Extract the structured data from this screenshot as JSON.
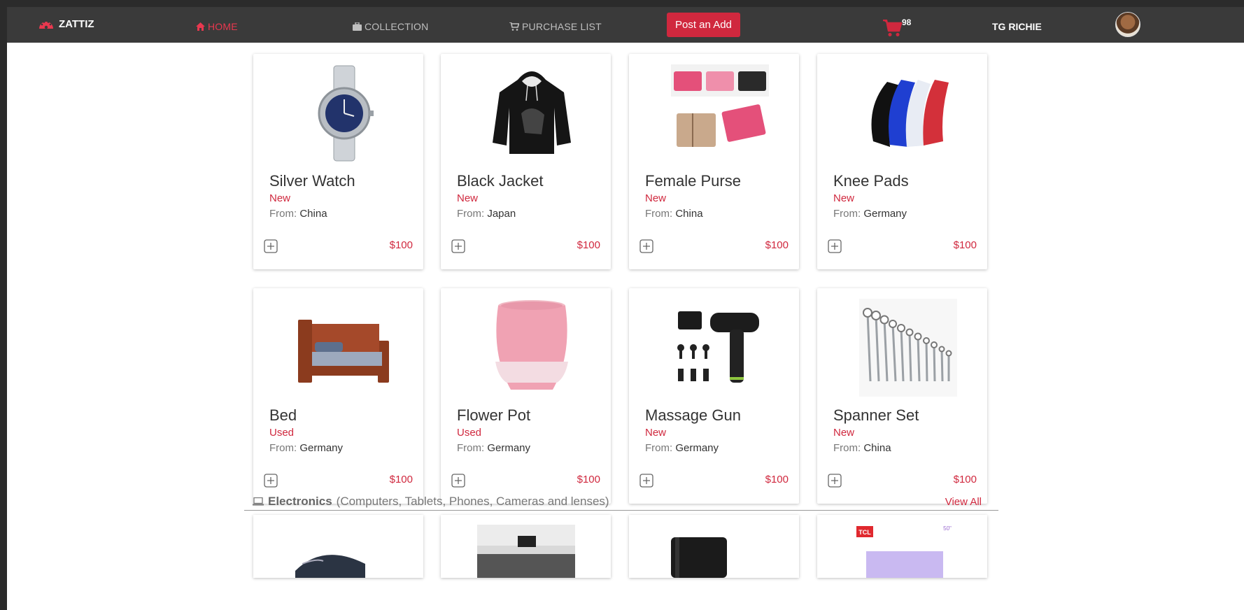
{
  "nav": {
    "brand": "ZATTIZ",
    "home": "HOME",
    "collection": "COLLECTION",
    "purchase_list": "PURCHASE LIST",
    "post_button": "Post an Add",
    "cart_count": "98",
    "username": "TG RICHIE"
  },
  "colors": {
    "accent": "#d0283e",
    "navbar": "#3a3a3a"
  },
  "products": [
    {
      "title": "Silver Watch",
      "condition": "New",
      "from_label": "From:",
      "country": "China",
      "price": "$100",
      "icon": "watch-icon"
    },
    {
      "title": "Black Jacket",
      "condition": "New",
      "from_label": "From:",
      "country": "Japan",
      "price": "$100",
      "icon": "hoodie-icon"
    },
    {
      "title": "Female Purse",
      "condition": "New",
      "from_label": "From:",
      "country": "China",
      "price": "$100",
      "icon": "purse-icon"
    },
    {
      "title": "Knee Pads",
      "condition": "New",
      "from_label": "From:",
      "country": "Germany",
      "price": "$100",
      "icon": "knee-pads-icon"
    },
    {
      "title": "Bed",
      "condition": "Used",
      "from_label": "From:",
      "country": "Germany",
      "price": "$100",
      "icon": "bed-icon"
    },
    {
      "title": "Flower Pot",
      "condition": "Used",
      "from_label": "From:",
      "country": "Germany",
      "price": "$100",
      "icon": "flower-pot-icon"
    },
    {
      "title": "Massage Gun",
      "condition": "New",
      "from_label": "From:",
      "country": "Germany",
      "price": "$100",
      "icon": "massage-gun-icon"
    },
    {
      "title": "Spanner Set",
      "condition": "New",
      "from_label": "From:",
      "country": "China",
      "price": "$100",
      "icon": "spanner-set-icon"
    }
  ],
  "section": {
    "title": "Electronics",
    "subtitle": "(Computers, Tablets, Phones, Cameras and lenses)",
    "view_all": "View All",
    "tv_brand": "TCL",
    "tv_size": "50\""
  }
}
